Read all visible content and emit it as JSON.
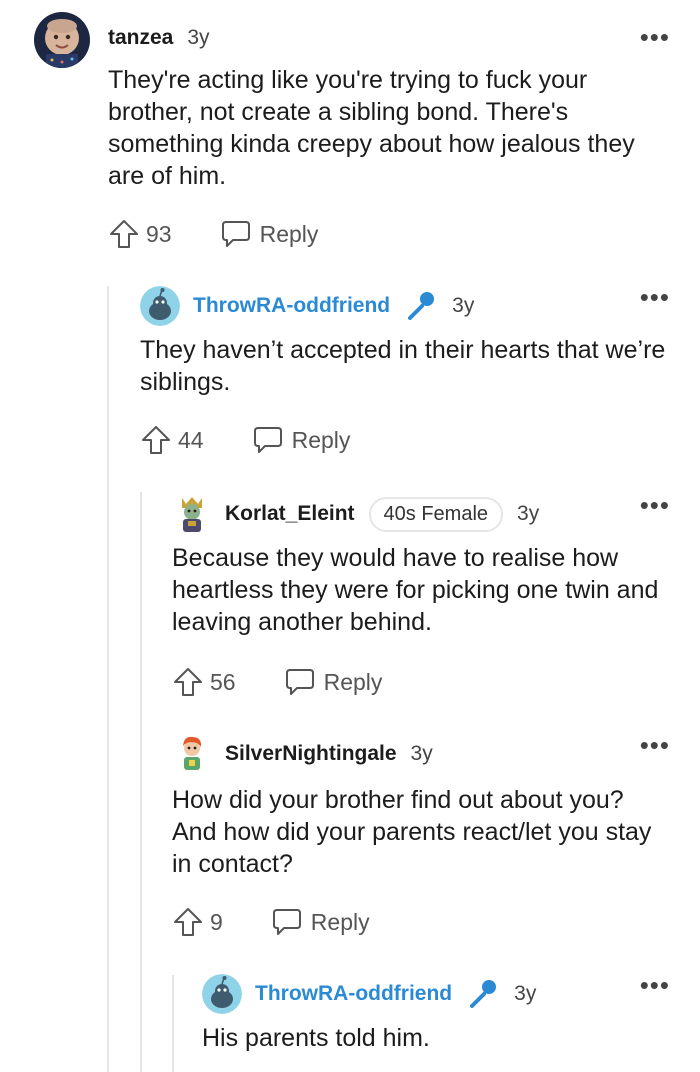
{
  "comments": [
    {
      "author": "tanzea",
      "age": "3y",
      "body": "They're acting like you're trying to fuck your brother, not create a sibling bond. There's something kinda creepy about how jealous they are of him.",
      "votes": "93",
      "reply_label": "Reply",
      "more_label": "•••"
    },
    {
      "author": "ThrowRA-oddfriend",
      "age": "3y",
      "body": "They haven’t accepted in their hearts that we’re siblings.",
      "votes": "44",
      "reply_label": "Reply",
      "more_label": "•••",
      "badge_icon": "microphone-icon"
    },
    {
      "author": "Korlat_Eleint",
      "flair": "40s Female",
      "age": "3y",
      "body": "Because they would have to realise how heartless they were for picking one twin and leaving another behind.",
      "votes": "56",
      "reply_label": "Reply",
      "more_label": "•••"
    },
    {
      "author": "SilverNightingale",
      "age": "3y",
      "body": "How did your brother find out about you? And how did your parents react/let you stay in contact?",
      "votes": "9",
      "reply_label": "Reply",
      "more_label": "•••"
    },
    {
      "author": "ThrowRA-oddfriend",
      "age": "3y",
      "body": "His parents told him.",
      "more_label": "•••",
      "badge_icon": "microphone-icon"
    }
  ],
  "colors": {
    "op_author": "#2b8ad4",
    "thread_line": "#e5e5e5",
    "text": "#1c1c1c"
  }
}
